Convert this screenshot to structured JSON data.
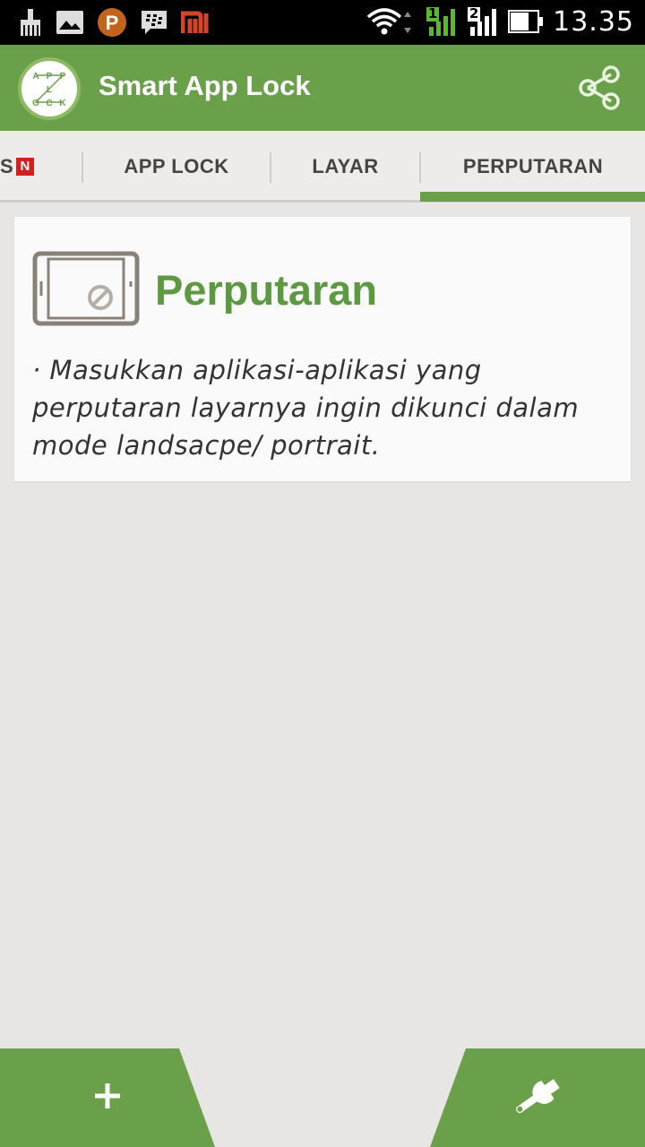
{
  "status_bar": {
    "time": "13.35",
    "sim1_label": "1",
    "sim2_label": "2",
    "icons": [
      "broom-icon",
      "gallery-icon",
      "p-icon",
      "bbm-icon",
      "mi-icon",
      "wifi-icon",
      "signal-icon",
      "battery-icon"
    ]
  },
  "app_bar": {
    "title": "Smart App Lock",
    "logo_letters": [
      "A",
      "P",
      "P",
      "L",
      "O",
      "C",
      "K"
    ],
    "share_icon": "share-icon"
  },
  "tabs": {
    "items": [
      {
        "label": "S",
        "badge": "N"
      },
      {
        "label": "APP LOCK"
      },
      {
        "label": "LAYAR"
      },
      {
        "label": "PERPUTARAN",
        "active": true
      }
    ]
  },
  "card": {
    "title": "Perputaran",
    "body": "· Masukkan aplikasi-aplikasi yang perputaran layarnya ingin dikunci dalam mode landsacpe/ portrait.",
    "icon": "rotation-lock-icon"
  },
  "bottom": {
    "add_icon": "plus-icon",
    "settings_icon": "wrench-icon"
  },
  "colors": {
    "accent": "#6ba04a",
    "title_green": "#5c9940",
    "badge_red": "#d41f1f",
    "background": "#e8e6e4"
  }
}
